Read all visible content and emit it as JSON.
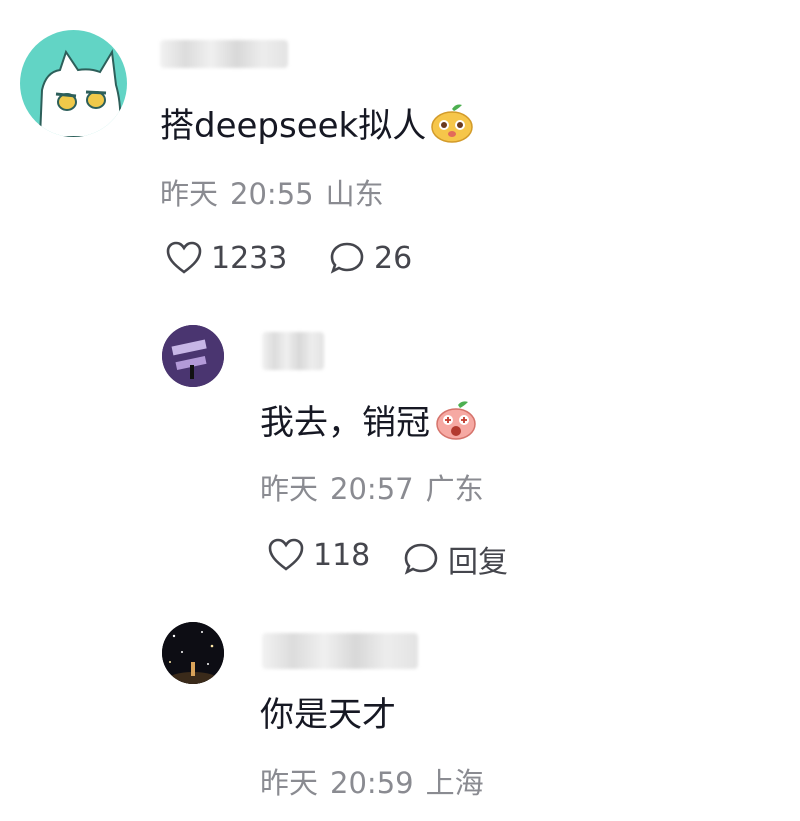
{
  "comments": [
    {
      "text": "搭deepseek拟人",
      "emoji": "mango-face-emoji",
      "date": "昨天",
      "time": "20:55",
      "location": "山东",
      "likes": "1233",
      "replies": "26"
    },
    {
      "text": "我去，销冠",
      "emoji": "peach-shocked-emoji",
      "date": "昨天",
      "time": "20:57",
      "location": "广东",
      "likes": "118",
      "reply_label": "回复"
    },
    {
      "text": "你是天才",
      "date": "昨天",
      "time": "20:59",
      "location": "上海"
    }
  ],
  "colors": {
    "text": "#161823",
    "meta": "#8a8b91",
    "avatar1": "#5ed3c3"
  }
}
